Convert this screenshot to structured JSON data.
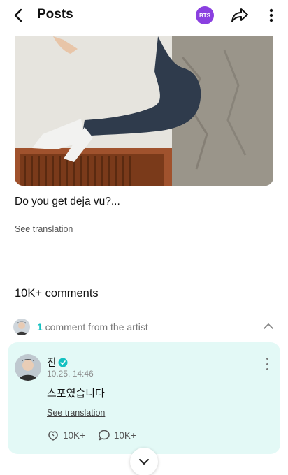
{
  "header": {
    "title": "Posts",
    "community_badge": "BTS"
  },
  "post": {
    "text": "Do you get deja vu?...",
    "see_translation": "See translation"
  },
  "comments": {
    "count_label": "10K+ comments",
    "artist_row": {
      "count": "1",
      "label": " comment from the artist"
    },
    "highlight": {
      "author": "진",
      "date": "10.25. 14:46",
      "text": "스포였습니다",
      "see_translation": "See translation",
      "likes": "10K+",
      "replies": "10K+"
    }
  },
  "colors": {
    "accent_teal": "#14c1c1",
    "badge_purple": "#8a3fe0",
    "card_bg": "#e3f9f6"
  }
}
